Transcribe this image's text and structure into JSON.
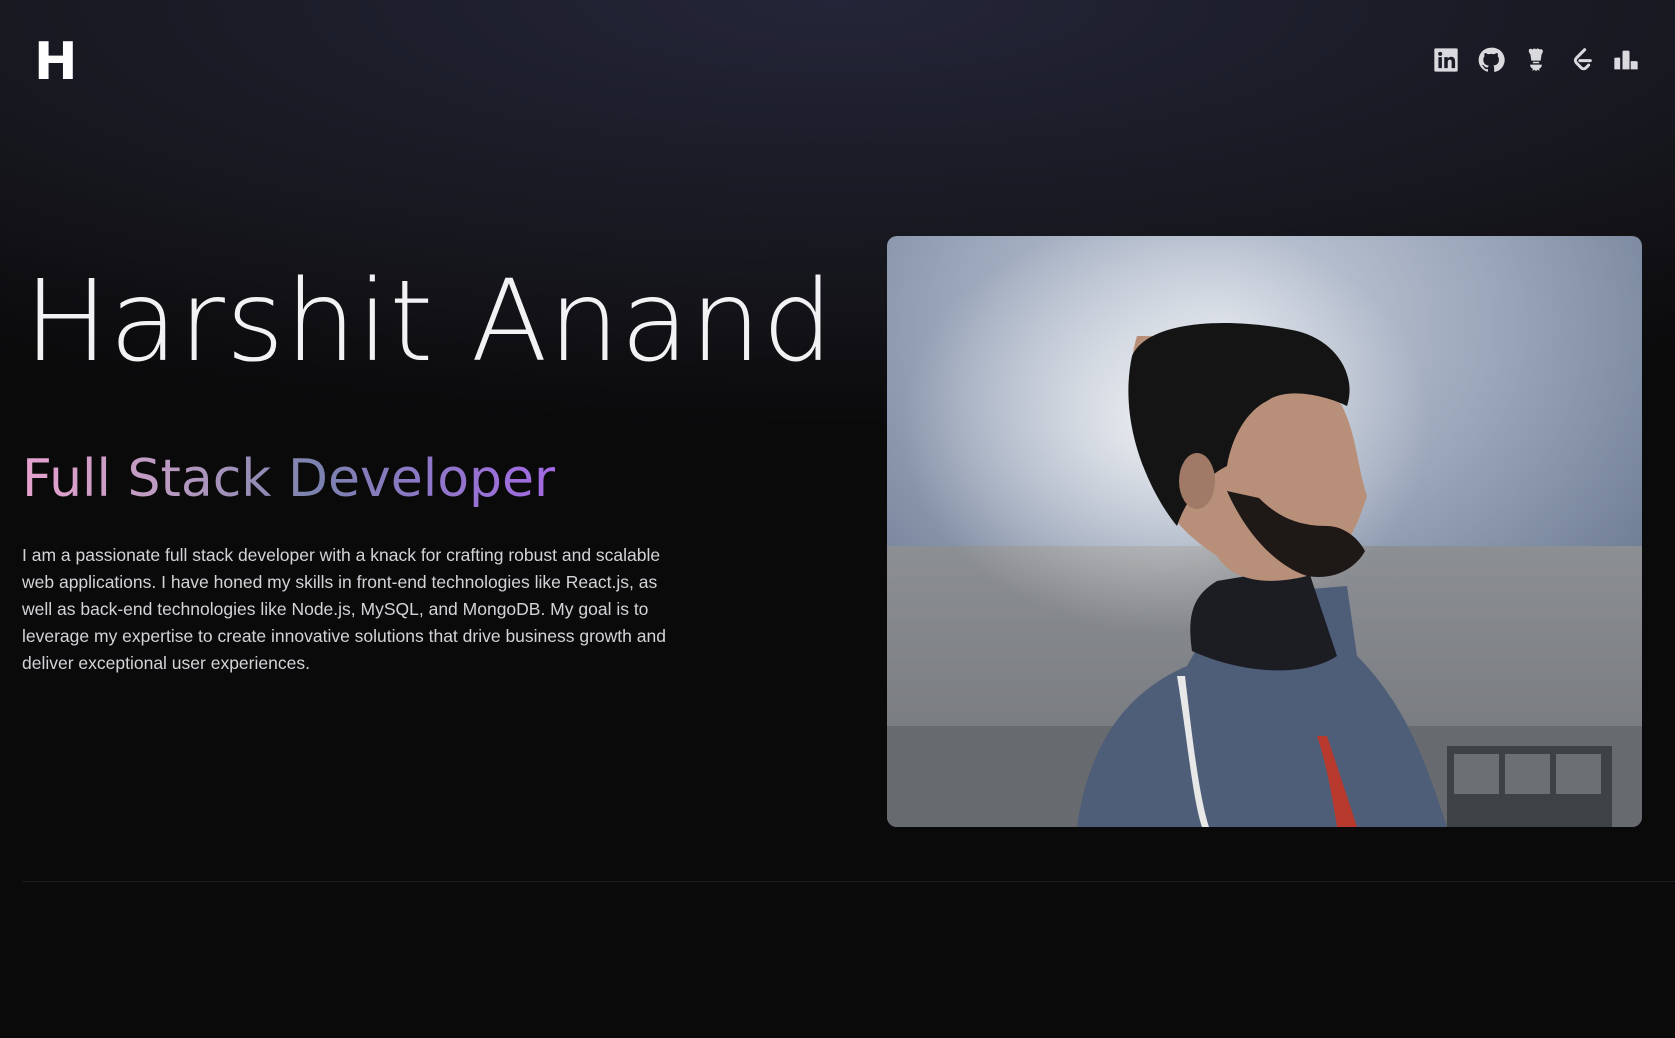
{
  "header": {
    "logo_text": "H",
    "socials": [
      {
        "name": "LinkedIn",
        "icon": "linkedin-icon"
      },
      {
        "name": "GitHub",
        "icon": "github-icon"
      },
      {
        "name": "CodeChef",
        "icon": "codechef-icon"
      },
      {
        "name": "LeetCode",
        "icon": "leetcode-icon"
      },
      {
        "name": "Stats",
        "icon": "bar-chart-icon"
      }
    ]
  },
  "hero": {
    "name": "Harshit Anand",
    "role": "Full Stack Developer",
    "bio": "I am a passionate full stack developer with a knack for crafting robust and scalable web applications. I have honed my skills in front-end technologies like React.js, as well as back-end technologies like Node.js, MySQL, and MongoDB. My goal is to leverage my expertise to create innovative solutions that drive business growth and deliver exceptional user experiences."
  },
  "colors": {
    "background": "#0a0a0b",
    "role_gradient": [
      "#e7a2cf",
      "#7b82ae",
      "#a46ae4"
    ],
    "text": "#f2f2f4"
  }
}
